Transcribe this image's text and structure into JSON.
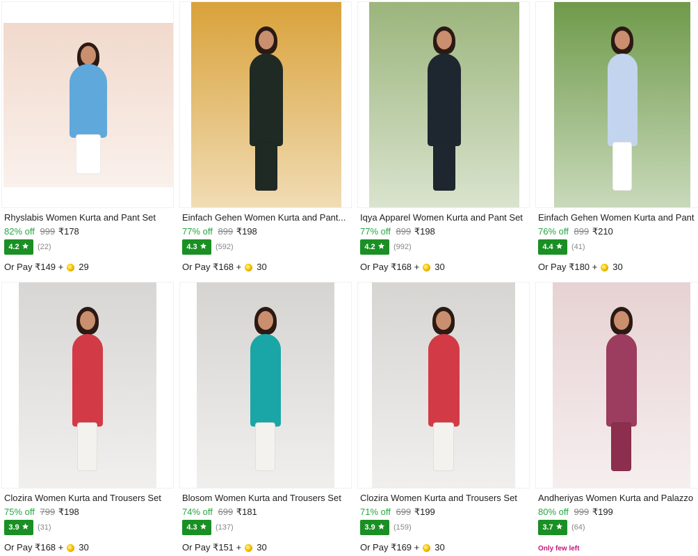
{
  "products": [
    {
      "title": "Rhyslabis Women Kurta and Pant Set",
      "discount": "82% off",
      "mrp": "999",
      "price": "₹178",
      "rating": "4.2",
      "reviews": "(22)",
      "pay_price": "Or Pay ₹149 +",
      "coins": "29",
      "colors": {
        "bg": "#f1d9cc",
        "body": "#5fa8db",
        "pants": "#ffffff"
      }
    },
    {
      "title": "Einfach Gehen Women Kurta and Pant...",
      "discount": "77% off",
      "mrp": "899",
      "price": "₹198",
      "rating": "4.3",
      "reviews": "(592)",
      "pay_price": "Or Pay ₹168 +",
      "coins": "30",
      "colors": {
        "bg": "#d9a23a",
        "body": "#1f2a24",
        "pants": "#1f2a24"
      }
    },
    {
      "title": "Iqya Apparel Women Kurta and Pant Set",
      "discount": "77% off",
      "mrp": "899",
      "price": "₹198",
      "rating": "4.2",
      "reviews": "(992)",
      "pay_price": "Or Pay ₹168 +",
      "coins": "30",
      "colors": {
        "bg": "#9bb57c",
        "body": "#1e2730",
        "pants": "#1e2730"
      }
    },
    {
      "title": "Einfach Gehen Women Kurta and Pant",
      "discount": "76% off",
      "mrp": "899",
      "price": "₹210",
      "rating": "4.4",
      "reviews": "(41)",
      "pay_price": "Or Pay ₹180 +",
      "coins": "30",
      "colors": {
        "bg": "#6f9a4a",
        "body": "#c3d4ee",
        "pants": "#ffffff"
      }
    },
    {
      "title": "Clozira Women Kurta and Trousers Set",
      "discount": "75% off",
      "mrp": "799",
      "price": "₹198",
      "rating": "3.9",
      "reviews": "(31)",
      "pay_price": "Or Pay ₹168 +",
      "coins": "30",
      "colors": {
        "bg": "#d8d6d4",
        "body": "#d23b46",
        "pants": "#f4f2ee"
      }
    },
    {
      "title": "Blosom Women Kurta and Trousers Set",
      "discount": "74% off",
      "mrp": "699",
      "price": "₹181",
      "rating": "4.3",
      "reviews": "(137)",
      "pay_price": "Or Pay ₹151 +",
      "coins": "30",
      "colors": {
        "bg": "#d6d4d1",
        "body": "#1aa6a6",
        "pants": "#f4f2ee"
      }
    },
    {
      "title": "Clozira Women Kurta and Trousers Set",
      "discount": "71% off",
      "mrp": "699",
      "price": "₹199",
      "rating": "3.9",
      "reviews": "(159)",
      "pay_price": "Or Pay ₹169 +",
      "coins": "30",
      "colors": {
        "bg": "#d7d5d2",
        "body": "#d23b46",
        "pants": "#f4f2ee"
      }
    },
    {
      "title": "Andheriyas Women Kurta and Palazzo",
      "discount": "80% off",
      "mrp": "999",
      "price": "₹199",
      "rating": "3.7",
      "reviews": "(64)",
      "stock_note": "Only few left",
      "colors": {
        "bg": "#e7d2d3",
        "body": "#9c3c5e",
        "pants": "#8c2f4f"
      }
    }
  ],
  "icons": {
    "rating": "star-icon",
    "coin": "supercoin-icon"
  },
  "theme": {
    "discount_green": "#26a541",
    "rating_green": "#1a8f24",
    "muted_gray": "#878787",
    "stock_pink": "#c7167c"
  }
}
